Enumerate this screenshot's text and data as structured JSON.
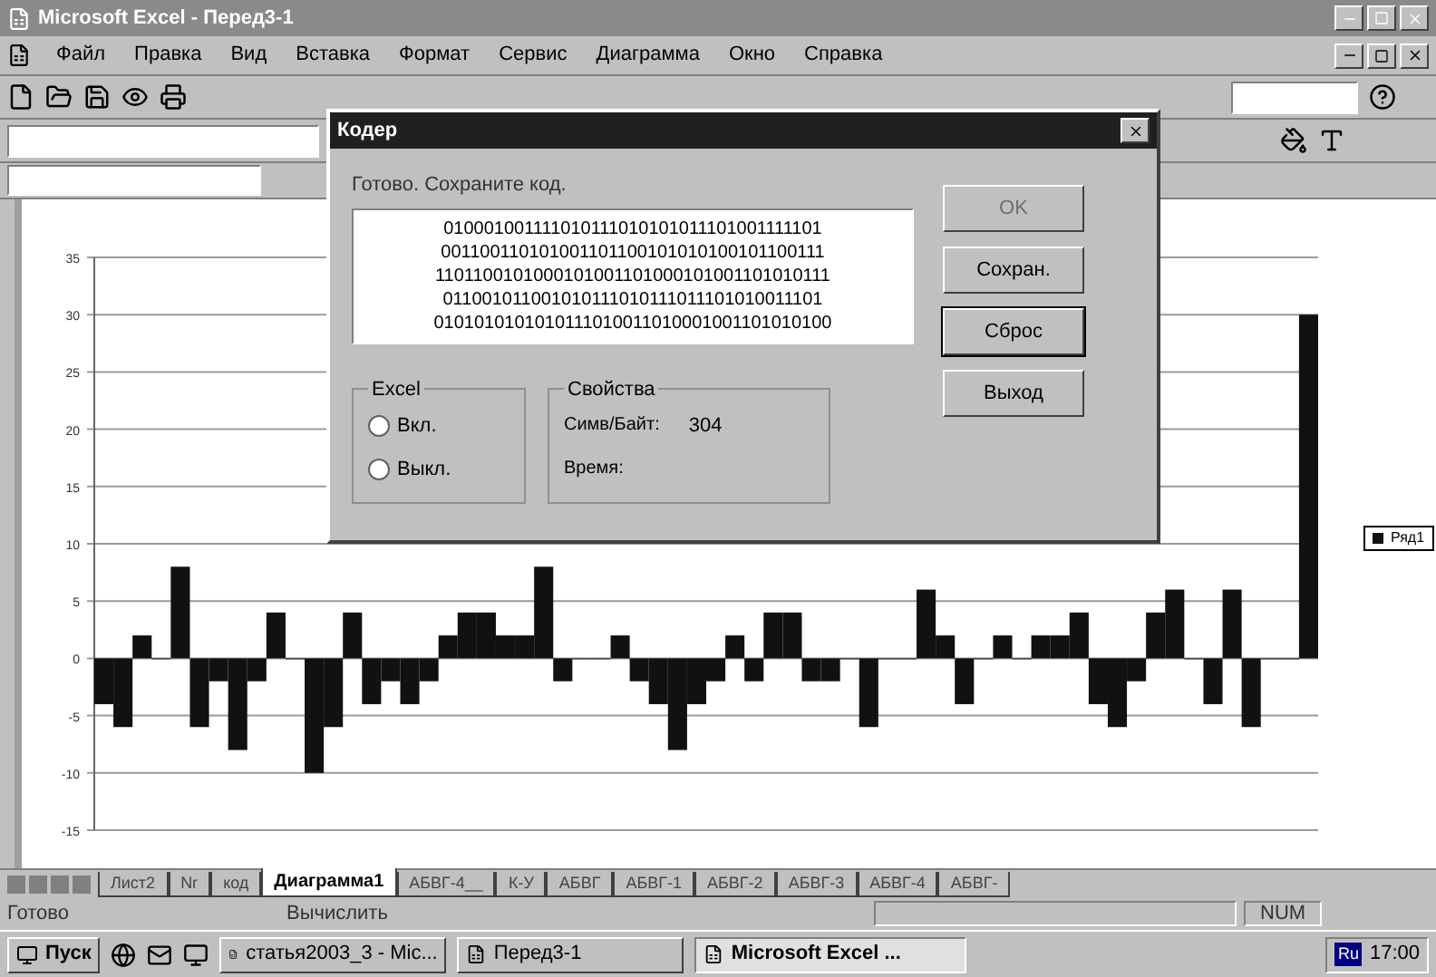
{
  "window": {
    "title": "Microsoft Excel - Перед3-1"
  },
  "menu": [
    "Файл",
    "Правка",
    "Вид",
    "Вставка",
    "Формат",
    "Сервис",
    "Диаграмма",
    "Окно",
    "Справка"
  ],
  "chart": {
    "chart_data": {
      "type": "bar",
      "grid": true,
      "ylim": [
        -15,
        35
      ],
      "yticks": [
        -15,
        -10,
        -5,
        0,
        5,
        10,
        15,
        20,
        25,
        30,
        35
      ],
      "series": [
        {
          "name": "Ряд1",
          "color": "#111111",
          "values": [
            -4,
            -6,
            2,
            0,
            8,
            -6,
            -2,
            -8,
            -2,
            4,
            0,
            -10,
            -6,
            4,
            -4,
            -2,
            -4,
            -2,
            2,
            4,
            4,
            2,
            2,
            8,
            -2,
            0,
            0,
            2,
            -2,
            -4,
            -8,
            -4,
            -2,
            2,
            -2,
            4,
            4,
            -2,
            -2,
            0,
            -6,
            0,
            0,
            6,
            2,
            -4,
            0,
            2,
            0,
            2,
            2,
            4,
            -4,
            -6,
            -2,
            4,
            6,
            0,
            -4,
            6,
            -6,
            0,
            0,
            30
          ]
        }
      ]
    }
  },
  "dialog": {
    "title": "Кодер",
    "message": "Готово. Сохраните код.",
    "code_lines": [
      "010001001111010111010101011101001111101",
      "001100110101001101100101010100101100111",
      "1101100101000101001101000101001101010111",
      "011001011001010111010111011101010011101",
      "0101010101010111010011010001001101010100"
    ],
    "buttons": [
      {
        "label": "OK",
        "disabled": true,
        "default": false
      },
      {
        "label": "Сохран.",
        "disabled": false,
        "default": false
      },
      {
        "label": "Сброс",
        "disabled": false,
        "default": true
      },
      {
        "label": "Выход",
        "disabled": false,
        "default": false
      }
    ],
    "excel_group": {
      "title": "Excel",
      "radios": [
        {
          "label": "Вкл.",
          "selected": false
        },
        {
          "label": "Выкл.",
          "selected": false
        }
      ]
    },
    "properties": {
      "title": "Свойства",
      "rows": [
        {
          "label": "Симв/Байт:",
          "value": "304"
        },
        {
          "label": "Время:"
        }
      ]
    }
  },
  "sheet_tabs": [
    {
      "label": "Лист2",
      "selected": false
    },
    {
      "label": "Nr",
      "selected": false
    },
    {
      "label": "код",
      "selected": false
    },
    {
      "label": "Диаграмма1",
      "selected": true
    },
    {
      "label": "АБВГ-4__",
      "selected": false
    },
    {
      "label": "К-У",
      "selected": false
    },
    {
      "label": "АБВГ",
      "selected": false
    },
    {
      "label": "АБВГ-1",
      "selected": false
    },
    {
      "label": "АБВГ-2",
      "selected": false
    },
    {
      "label": "АБВГ-3",
      "selected": false
    },
    {
      "label": "АБВГ-4",
      "selected": false
    },
    {
      "label": "АБВГ-",
      "selected": false
    }
  ],
  "status_bar": {
    "left": "Готово",
    "middle": "Вычислить",
    "indicator": "NUM"
  },
  "taskbar": {
    "start": "Пуск",
    "tasks": [
      {
        "label": "статья2003_3 - Mic...",
        "selected": false
      },
      {
        "label": "Перед3-1",
        "selected": false
      },
      {
        "label": "Microsoft Excel ...",
        "selected": true
      }
    ],
    "language": "Ru",
    "clock": "17:00"
  }
}
